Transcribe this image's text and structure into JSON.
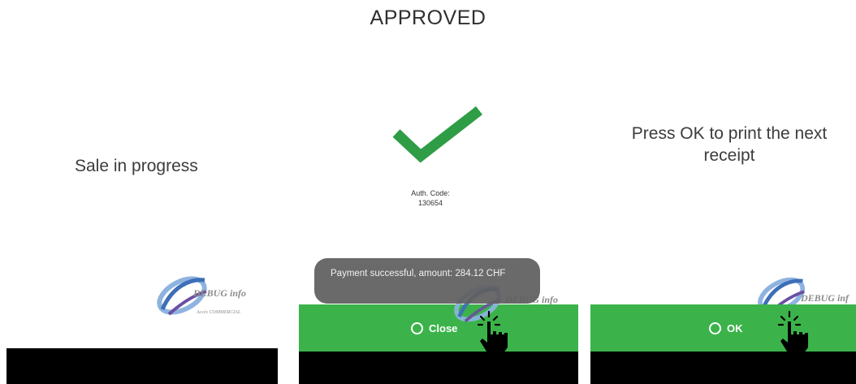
{
  "header": {
    "title": "APPROVED"
  },
  "left_panel": {
    "message": "Sale in progress"
  },
  "center_panel": {
    "auth_label": "Auth. Code:",
    "auth_code": "130654",
    "toast_message": "Payment successful, amount: 284.12 CHF",
    "close_label": "Close"
  },
  "right_panel": {
    "message": "Press OK to print the next receipt",
    "ok_label": "OK"
  },
  "watermark": {
    "brand": "DEBUG info",
    "brand_short": "DEBUG info",
    "brand_right": "DEBUG inf",
    "tagline": "Accès COMMERCIAL"
  },
  "colors": {
    "approve_green": "#2e9d45",
    "button_green": "#3bb34a",
    "toast_bg": "#5f5f5f",
    "bar_black": "#000000"
  },
  "icons": [
    "check-icon",
    "radio-icon",
    "hand-pointer-icon",
    "logo-swoosh-icon"
  ]
}
